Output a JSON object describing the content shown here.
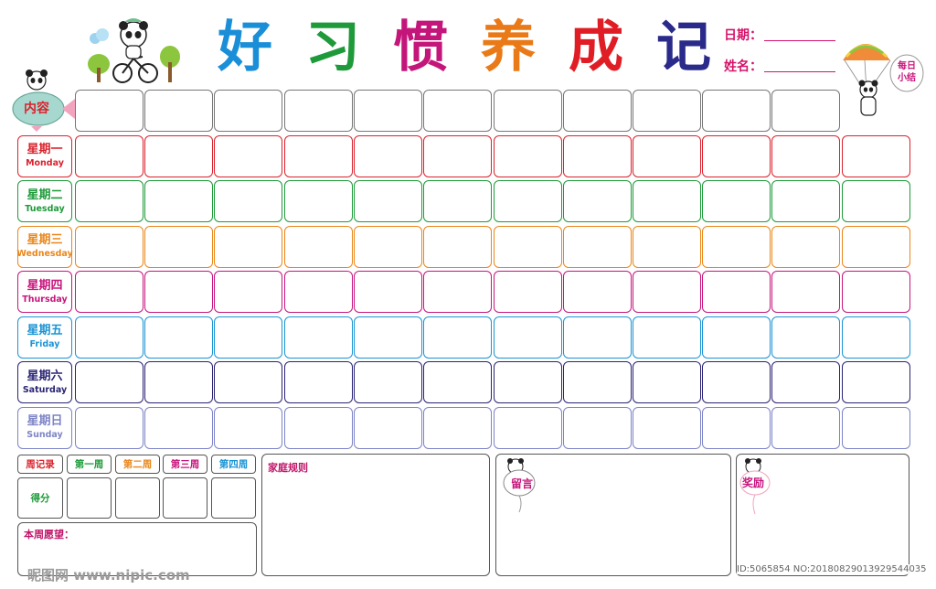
{
  "title": {
    "chars": [
      {
        "char": "好",
        "color": "#1a8fd8"
      },
      {
        "char": "习",
        "color": "#1f9a3a"
      },
      {
        "char": "惯",
        "color": "#c4167a"
      },
      {
        "char": "养",
        "color": "#e97a17"
      },
      {
        "char": "成",
        "color": "#e01d25"
      },
      {
        "char": "记",
        "color": "#2a2a8a"
      }
    ]
  },
  "header_fields": {
    "date_label": "日期：",
    "name_label": "姓名："
  },
  "content_label": "内容",
  "daily_summary_label": [
    "每日",
    "小结"
  ],
  "days": [
    {
      "cn": "星期一",
      "en": "Monday",
      "color": "#d9232d"
    },
    {
      "cn": "星期二",
      "en": "Tuesday",
      "color": "#1f9a3a"
    },
    {
      "cn": "星期三",
      "en": "Wednesday",
      "color": "#e9871b"
    },
    {
      "cn": "星期四",
      "en": "Thursday",
      "color": "#c7157d"
    },
    {
      "cn": "星期五",
      "en": "Friday",
      "color": "#1b94d4"
    },
    {
      "cn": "星期六",
      "en": "Saturday",
      "color": "#2a2473"
    },
    {
      "cn": "星期日",
      "en": "Sunday",
      "color": "#7d84c7"
    }
  ],
  "weekly": {
    "record_label": "周记录",
    "weeks": [
      {
        "label": "第一周",
        "color": "#1f9a3a"
      },
      {
        "label": "第二周",
        "color": "#e9871b"
      },
      {
        "label": "第三周",
        "color": "#c7157d"
      },
      {
        "label": "第四周",
        "color": "#1b94d4"
      }
    ],
    "record_color": "#d9232d",
    "score_label": "得分",
    "score_color": "#1f9a3a",
    "wish_label": "本周愿望："
  },
  "panels": {
    "family_rules": "家庭规则",
    "message": "留言",
    "reward": "奖励"
  },
  "watermark": {
    "left": "昵图网 www.nipic.com",
    "right": "ID:5065854 NO:20180829013929544035"
  }
}
